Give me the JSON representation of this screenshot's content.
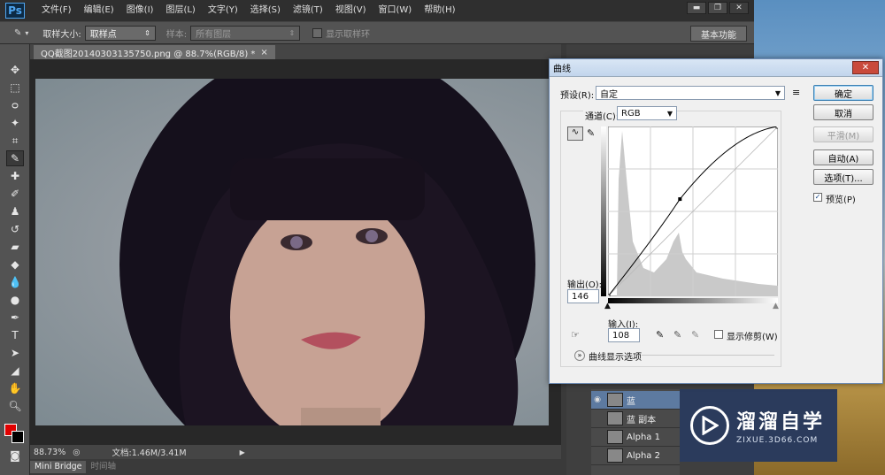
{
  "app": {
    "logo": "Ps",
    "menu": [
      "文件(F)",
      "编辑(E)",
      "图像(I)",
      "图层(L)",
      "文字(Y)",
      "选择(S)",
      "滤镜(T)",
      "视图(V)",
      "窗口(W)",
      "帮助(H)"
    ],
    "window_controls": [
      "minimize",
      "restore",
      "close"
    ]
  },
  "options_bar": {
    "sample_size_label": "取样大小:",
    "sample_size_value": "取样点",
    "sample_label": "样本:",
    "sample_value": "所有图层",
    "show_ring_label": "显示取样环",
    "workspace": "基本功能"
  },
  "document": {
    "tab_title": "QQ截图20140303135750.png @ 88.7%(RGB/8) *",
    "zoom": "88.73%",
    "doc_info": "文档:1.46M/3.41M",
    "bottom_tabs": [
      "Mini Bridge",
      "时间轴"
    ]
  },
  "layers": [
    {
      "name": "蓝",
      "selected": true
    },
    {
      "name": "蓝 副本",
      "selected": false
    },
    {
      "name": "Alpha 1",
      "selected": false
    },
    {
      "name": "Alpha 2",
      "selected": false
    }
  ],
  "curves": {
    "title": "曲线",
    "preset_label": "预设(R):",
    "preset_value": "自定",
    "channel_label": "通道(C):",
    "channel_value": "RGB",
    "output_label": "输出(O):",
    "output_value": "146",
    "input_label": "输入(I):",
    "input_value": "108",
    "show_clipping_label": "显示修剪(W)",
    "display_options_label": "曲线显示选项",
    "buttons": {
      "ok": "确定",
      "cancel": "取消",
      "smooth": "平滑(M)",
      "auto": "自动(A)",
      "options": "选项(T)..."
    },
    "preview_label": "预览(P)",
    "preview_checked": true,
    "control_point": {
      "input": 108,
      "output": 146
    }
  },
  "watermark": {
    "title": "溜溜自学",
    "subtitle": "ZIXUE.3D66.COM"
  },
  "colors": {
    "foreground": "#e00000",
    "background": "#000000"
  }
}
